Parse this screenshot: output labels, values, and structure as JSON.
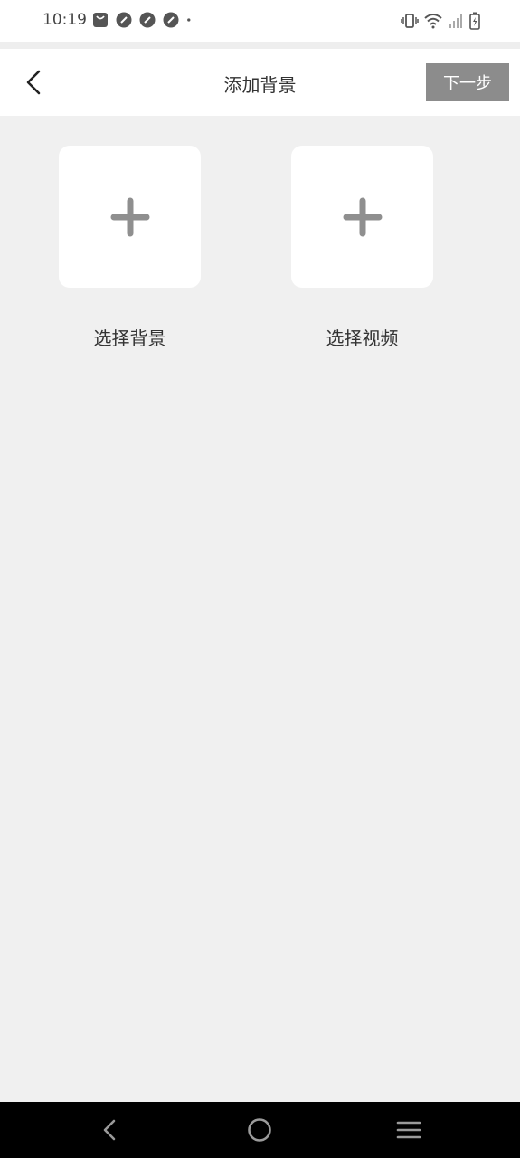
{
  "status_bar": {
    "time": "10:19",
    "left_icons": [
      "shopping-bag-icon",
      "notification-app-icon",
      "notification-app-icon",
      "notification-app-icon",
      "more-dot-icon"
    ],
    "right_icons": [
      "vibrate-icon",
      "wifi-icon",
      "signal-icon",
      "battery-charging-icon"
    ]
  },
  "header": {
    "title": "添加背景",
    "next_label": "下一步",
    "back_icon": "chevron-left-icon"
  },
  "tiles": [
    {
      "label": "选择背景",
      "icon": "plus-icon"
    },
    {
      "label": "选择视频",
      "icon": "plus-icon"
    }
  ],
  "nav_bar": {
    "items": [
      "back-triangle-icon",
      "home-circle-icon",
      "menu-lines-icon"
    ]
  },
  "colors": {
    "background": "#f0f0f0",
    "header": "#ffffff",
    "next_button": "#8c8c8c",
    "plus": "#8f8f8f"
  }
}
